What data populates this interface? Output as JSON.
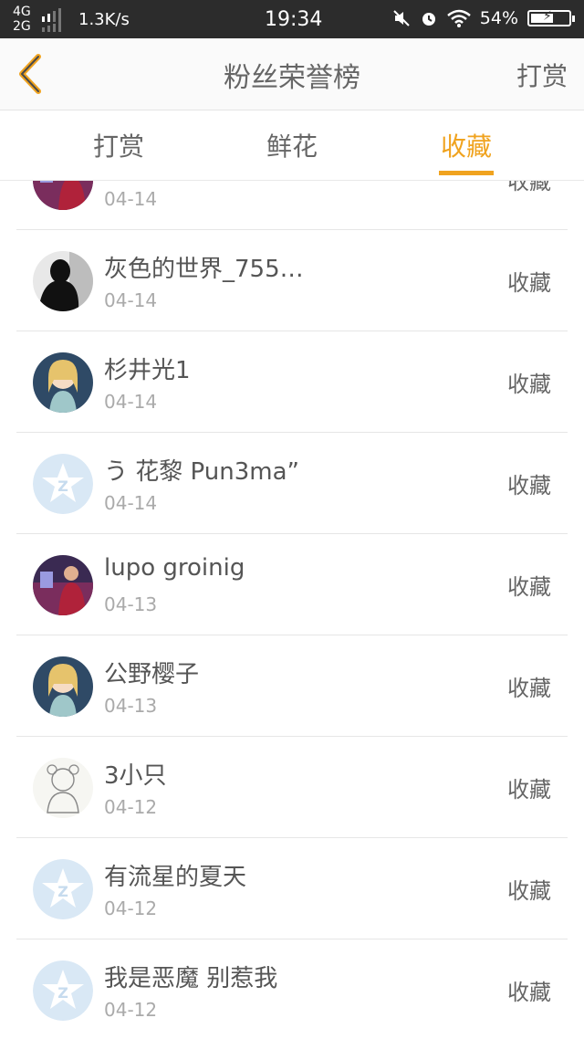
{
  "status_bar": {
    "network_top": "4G",
    "network_bottom": "2G",
    "speed": "1.3K/s",
    "time": "19:34",
    "battery": "54%",
    "battery_level": 0.54
  },
  "header": {
    "title": "粉丝荣誉榜",
    "right_action": "打赏"
  },
  "tabs": [
    {
      "label": "打赏",
      "active": false
    },
    {
      "label": "鲜花",
      "active": false
    },
    {
      "label": "收藏",
      "active": true
    }
  ],
  "list": [
    {
      "name": "",
      "date": "04-14",
      "action": "收藏",
      "avatar": "photo-avatar"
    },
    {
      "name": "灰色的世界_755…",
      "date": "04-14",
      "action": "收藏",
      "avatar": "dark-silhouette-avatar"
    },
    {
      "name": "杉井光1",
      "date": "04-14",
      "action": "收藏",
      "avatar": "anime-avatar"
    },
    {
      "name": "う 花黎 Pun3ma”",
      "date": "04-14",
      "action": "收藏",
      "avatar": "default-avatar"
    },
    {
      "name": "lupo groinig",
      "date": "04-13",
      "action": "收藏",
      "avatar": "photo-avatar"
    },
    {
      "name": "公野樱子",
      "date": "04-13",
      "action": "收藏",
      "avatar": "anime-avatar"
    },
    {
      "name": "3小只",
      "date": "04-12",
      "action": "收藏",
      "avatar": "sketch-avatar"
    },
    {
      "name": "有流星的夏天",
      "date": "04-12",
      "action": "收藏",
      "avatar": "default-avatar"
    },
    {
      "name": "我是恶魔 别惹我",
      "date": "04-12",
      "action": "收藏",
      "avatar": "default-avatar"
    }
  ],
  "colors": {
    "accent": "#f0a31f",
    "status_bar": "#2c2c2c"
  }
}
